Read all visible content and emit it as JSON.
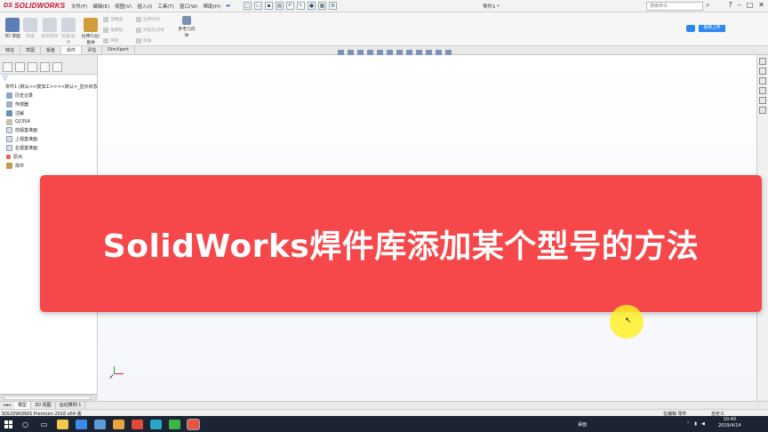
{
  "app": {
    "logo_prefix": "DS",
    "logo_text": "SOLIDWORKS",
    "document_title": "零件1 *",
    "search_placeholder": "搜索命令"
  },
  "menu": [
    "文件(F)",
    "编辑(E)",
    "视图(V)",
    "插入(I)",
    "工具(T)",
    "窗口(W)",
    "帮助(H)"
  ],
  "ribbon": {
    "sketch3d_label": "3D 草图",
    "convert_label": "转换",
    "equal_label": "结构构件",
    "trim_label": "剪裁/延伸",
    "extrude_label": "拉伸凸台/基体",
    "gusset_label": "顶端盖",
    "chamfer_label": "角撑板",
    "weld_label": "焊缝",
    "cut_label": "拉伸切除",
    "hole_label": "异型孔向导",
    "fillet_label": "倒角",
    "refgeo_label": "参考几何体",
    "share_label": "指南上传"
  },
  "tabs": [
    "特征",
    "草图",
    "钣金",
    "焊件",
    "评估",
    "DimXpert"
  ],
  "active_tab": "焊件",
  "tree": {
    "root": "零件1 (默认<<按加工>><<默认>_显示状态 1>)",
    "items": [
      "历史记录",
      "传感器",
      "注解",
      "Q235A",
      "前视基准面",
      "上视基准面",
      "右视基准面",
      "原点",
      "焊件"
    ]
  },
  "banner": {
    "title": "SolidWorks焊件库添加某个型号的方法",
    "bg_color": "#f6474a"
  },
  "model_tabs": [
    "模型",
    "3D 视图",
    "运动算例 1"
  ],
  "status": {
    "left": "SOLIDWORKS Premium 2016 x64 版",
    "mid": "在编辑 零件",
    "right": "自定义"
  },
  "taskbar": {
    "tray_label": "桌面",
    "time": "10:40",
    "date": "2019/4/14"
  }
}
